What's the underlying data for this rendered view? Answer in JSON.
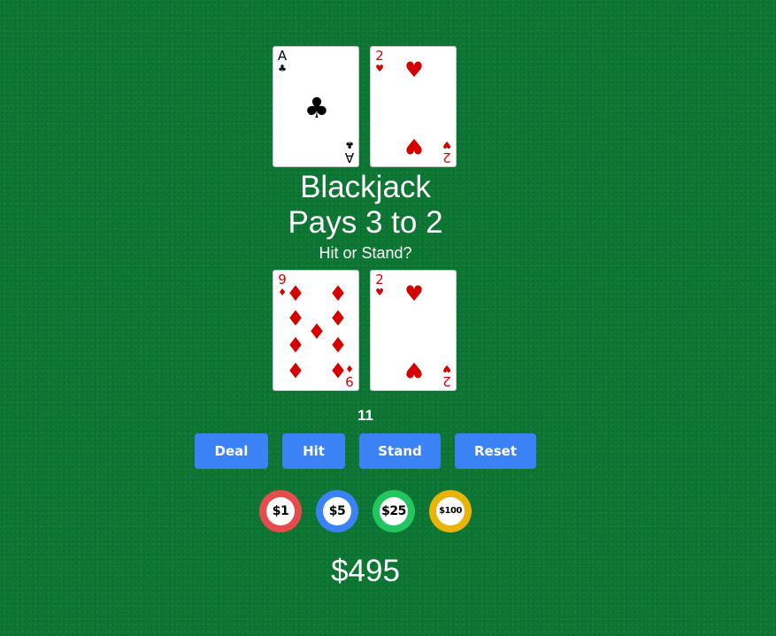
{
  "dealer": {
    "cards": [
      {
        "rank": "A",
        "suit": "♣",
        "color": "#000000"
      },
      {
        "rank": "2",
        "suit": "♥",
        "color": "#d40000"
      }
    ]
  },
  "table": {
    "title_line1": "Blackjack",
    "title_line2": "Pays 3 to 2",
    "prompt": "Hit or Stand?"
  },
  "player": {
    "cards": [
      {
        "rank": "9",
        "suit": "♦",
        "color": "#d40000"
      },
      {
        "rank": "2",
        "suit": "♥",
        "color": "#d40000"
      }
    ],
    "score": "11"
  },
  "controls": {
    "deal": "Deal",
    "hit": "Hit",
    "stand": "Stand",
    "reset": "Reset"
  },
  "chips": [
    {
      "label": "$1",
      "color": "#e74c4c"
    },
    {
      "label": "$5",
      "color": "#3b82f6"
    },
    {
      "label": "$25",
      "color": "#22c55e"
    },
    {
      "label": "$100",
      "color": "#eab308"
    }
  ],
  "bankroll": "$495",
  "colors": {
    "felt": "#0d7a35",
    "button": "#3b82f6",
    "red_suit": "#d40000"
  }
}
